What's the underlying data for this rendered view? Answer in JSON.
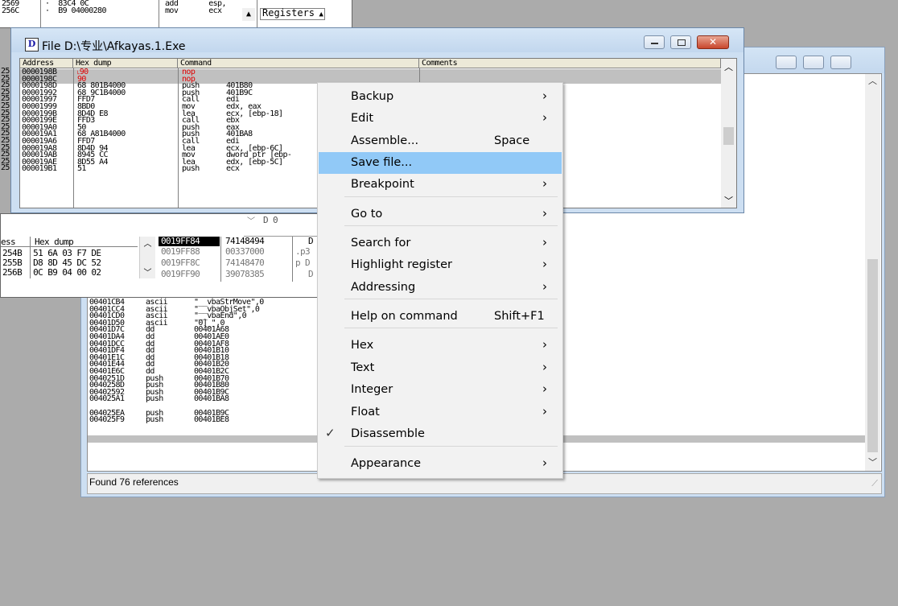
{
  "top_strip": {
    "rows": [
      {
        "addr": "2569",
        "dot": "·",
        "hex": "83C4 0C",
        "mnem": "add",
        "args": "esp,"
      },
      {
        "addr": "256C",
        "dot": "·",
        "hex": "B9 04000280",
        "mnem": "mov",
        "args": "ecx"
      }
    ],
    "registers_label": "Registers"
  },
  "cpu_window": {
    "icon_letter": "D",
    "title": "File D:\\专业\\Afkayas.1.Exe",
    "columns": [
      "Address",
      "Hex dump",
      "Command",
      "Comments"
    ],
    "rows": [
      {
        "addr": "0000198B",
        "hex": "˪90",
        "cmd": "nop",
        "args": "",
        "red": true
      },
      {
        "addr": "0000198C",
        "hex": "90",
        "cmd": "nop",
        "args": "",
        "red": true
      },
      {
        "addr": "0000198D",
        "hex": "68 801B4000",
        "cmd": "push",
        "args": "401B80",
        "red": false
      },
      {
        "addr": "00001992",
        "hex": "68 9C1B4000",
        "cmd": "push",
        "args": "401B9C",
        "red": false
      },
      {
        "addr": "00001997",
        "hex": "FFD7",
        "cmd": "call",
        "args": "edi",
        "red": false
      },
      {
        "addr": "00001999",
        "hex": "8BD0",
        "cmd": "mov",
        "args": "edx, eax",
        "red": false
      },
      {
        "addr": "0000199B",
        "hex": "8D4D E8",
        "cmd": "lea",
        "args": "ecx, [ebp-18]",
        "red": false
      },
      {
        "addr": "0000199E",
        "hex": "FFD3",
        "cmd": "call",
        "args": "ebx",
        "red": false
      },
      {
        "addr": "000019A0",
        "hex": "50",
        "cmd": "push",
        "args": "eax",
        "red": false
      },
      {
        "addr": "000019A1",
        "hex": "68 A81B4000",
        "cmd": "push",
        "args": "401BA8",
        "red": false
      },
      {
        "addr": "000019A6",
        "hex": "FFD7",
        "cmd": "call",
        "args": "edi",
        "red": false
      },
      {
        "addr": "000019A8",
        "hex": "8D4D 94",
        "cmd": "lea",
        "args": "ecx, [ebp-6C]",
        "red": false
      },
      {
        "addr": "000019AB",
        "hex": "8945 CC",
        "cmd": "mov",
        "args": "dword ptr [ebp-",
        "red": false
      },
      {
        "addr": "000019AE",
        "hex": "8D55 A4",
        "cmd": "lea",
        "args": "edx, [ebp-5C]",
        "red": false
      },
      {
        "addr": "000019B1",
        "hex": "51",
        "cmd": "push",
        "args": "ecx",
        "red": false
      }
    ],
    "left_gutter": [
      "25",
      "25",
      "25",
      "25",
      "25",
      "25",
      "25",
      "25",
      "25",
      "25",
      "25",
      "25",
      "25",
      "25",
      "25"
    ]
  },
  "dump_pane": {
    "columns": [
      "ess",
      "Hex dump"
    ],
    "rows": [
      {
        "addr": "254B",
        "hex": "51 6A 03 F7 DE"
      },
      {
        "addr": "255B",
        "hex": "D8 8D 45 DC 52"
      },
      {
        "addr": "256B",
        "hex": "0C B9 04 00 02"
      }
    ],
    "stack_addrs": [
      "0019FF84",
      "0019FF88",
      "0019FF8C",
      "0019FF90"
    ],
    "stack_vals": [
      "74148494",
      "00337000",
      "74148470",
      "39078385"
    ],
    "stack_tail": [
      "D",
      ".p3",
      "p D",
      "D"
    ],
    "dlabel": "D 0"
  },
  "refs_window": {
    "rows": [
      {
        "addr": "00401CB4",
        "cmd": "ascii",
        "args": "\"__vbaStrMove\",0"
      },
      {
        "addr": "00401CC4",
        "cmd": "ascii",
        "args": "\"__vbaObjSet\",0"
      },
      {
        "addr": "00401CD0",
        "cmd": "ascii",
        "args": "\"__vbaEnd\",0"
      },
      {
        "addr": "00401D50",
        "cmd": "ascii",
        "args": "\"0]_\",0"
      },
      {
        "addr": "00401D7C",
        "cmd": "dd",
        "args": "00401A68"
      },
      {
        "addr": "00401DA4",
        "cmd": "dd",
        "args": "00401AE0"
      },
      {
        "addr": "00401DCC",
        "cmd": "dd",
        "args": "00401AF8"
      },
      {
        "addr": "00401DF4",
        "cmd": "dd",
        "args": "00401B10"
      },
      {
        "addr": "00401E1C",
        "cmd": "dd",
        "args": "00401B18"
      },
      {
        "addr": "00401E44",
        "cmd": "dd",
        "args": "00401B20"
      },
      {
        "addr": "00401E6C",
        "cmd": "dd",
        "args": "00401B2C"
      },
      {
        "addr": "0040251D",
        "cmd": "push",
        "args": "00401B70"
      },
      {
        "addr": "0040258D",
        "cmd": "push",
        "args": "00401B80"
      },
      {
        "addr": "00402592",
        "cmd": "push",
        "args": "00401B9C"
      },
      {
        "addr": "004025A1",
        "cmd": "push",
        "args": "00401BA8"
      },
      {
        "addr": "004025E5",
        "cmd": "push",
        "args": "00401BC8"
      },
      {
        "addr": "004025EA",
        "cmd": "push",
        "args": "00401B9C"
      },
      {
        "addr": "004025F9",
        "cmd": "push",
        "args": "00401BE8"
      }
    ],
    "status": "Found 76 references"
  },
  "context_menu": {
    "items": [
      {
        "label": "Backup",
        "shortcut": "",
        "submenu": true
      },
      {
        "label": "Edit",
        "shortcut": "",
        "submenu": true
      },
      {
        "label": "Assemble...",
        "shortcut": "Space",
        "submenu": false
      },
      {
        "label": "Save file...",
        "shortcut": "",
        "submenu": false,
        "highlighted": true
      },
      {
        "label": "Breakpoint",
        "shortcut": "",
        "submenu": true
      },
      {
        "label": "Go to",
        "shortcut": "",
        "submenu": true
      },
      {
        "label": "Search for",
        "shortcut": "",
        "submenu": true
      },
      {
        "label": "Highlight register",
        "shortcut": "",
        "submenu": true
      },
      {
        "label": "Addressing",
        "shortcut": "",
        "submenu": true
      },
      {
        "label": "Help on command",
        "shortcut": "Shift+F1",
        "submenu": false
      },
      {
        "label": "Hex",
        "shortcut": "",
        "submenu": true
      },
      {
        "label": "Text",
        "shortcut": "",
        "submenu": true
      },
      {
        "label": "Integer",
        "shortcut": "",
        "submenu": true
      },
      {
        "label": "Float",
        "shortcut": "",
        "submenu": true
      },
      {
        "label": "Disassemble",
        "shortcut": "",
        "submenu": false,
        "checked": true
      },
      {
        "label": "Appearance",
        "shortcut": "",
        "submenu": true
      }
    ],
    "arrow_glyph": "›",
    "check_glyph": "✓",
    "highlight_color": "#91c9f7"
  },
  "colors": {
    "desktop": "#ababab",
    "red_text": "#e00000",
    "selected_row": "#c0c0c0",
    "titlebar": "#cddff2"
  }
}
